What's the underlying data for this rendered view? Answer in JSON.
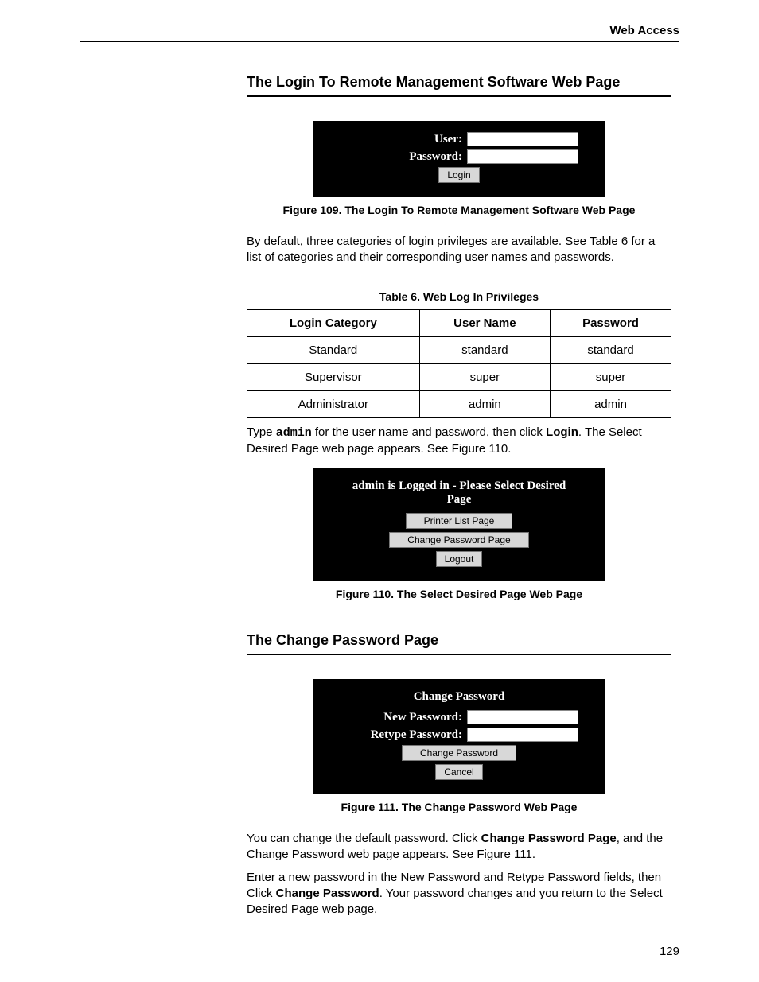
{
  "running_head": "Web Access",
  "section1": {
    "title": "The Login To Remote Management Software Web Page",
    "fig109": {
      "user_label": "User:",
      "password_label": "Password:",
      "login_btn": "Login",
      "caption": "Figure 109. The Login To Remote Management Software Web Page"
    },
    "p1_a": "By default, three categories of login privileges are available. See Table 6 for a list of categories and their corresponding user names and passwords.",
    "table6": {
      "caption": "Table 6. Web Log In Privileges",
      "headers": [
        "Login Category",
        "User Name",
        "Password"
      ],
      "rows": [
        [
          "Standard",
          "standard",
          "standard"
        ],
        [
          "Supervisor",
          "super",
          "super"
        ],
        [
          "Administrator",
          "admin",
          "admin"
        ]
      ]
    },
    "p2_a": "Type",
    "p2_code": "admin",
    "p2_b": "for the user name and password, then click",
    "p2_bold": "Login",
    "p2_c": ". The Select Desired Page web page appears. See Figure 110.",
    "fig110": {
      "header": "admin is Logged in - Please Select Desired Page",
      "btn1": "Printer List Page",
      "btn2": "Change Password Page",
      "btn3": "Logout",
      "caption": "Figure 110. The Select Desired Page Web Page"
    }
  },
  "section2": {
    "title": "The Change Password Page",
    "fig111": {
      "header": "Change Password",
      "new_pw_label": "New Password:",
      "retype_pw_label": "Retype Password:",
      "btn_change": "Change Password",
      "btn_cancel": "Cancel",
      "caption": "Figure 111. The Change Password Web Page"
    },
    "p1_a": "You can change the default password. Click",
    "p1_bold": "Change Password Page",
    "p1_b": ", and the Change Password web page appears. See Figure 111.",
    "p2_a": "Enter a new password in the New Password and Retype Password fields, then Click",
    "p2_bold": "Change Password",
    "p2_b": ". Your password changes and you return to the Select Desired Page web page."
  },
  "page_number": "129"
}
